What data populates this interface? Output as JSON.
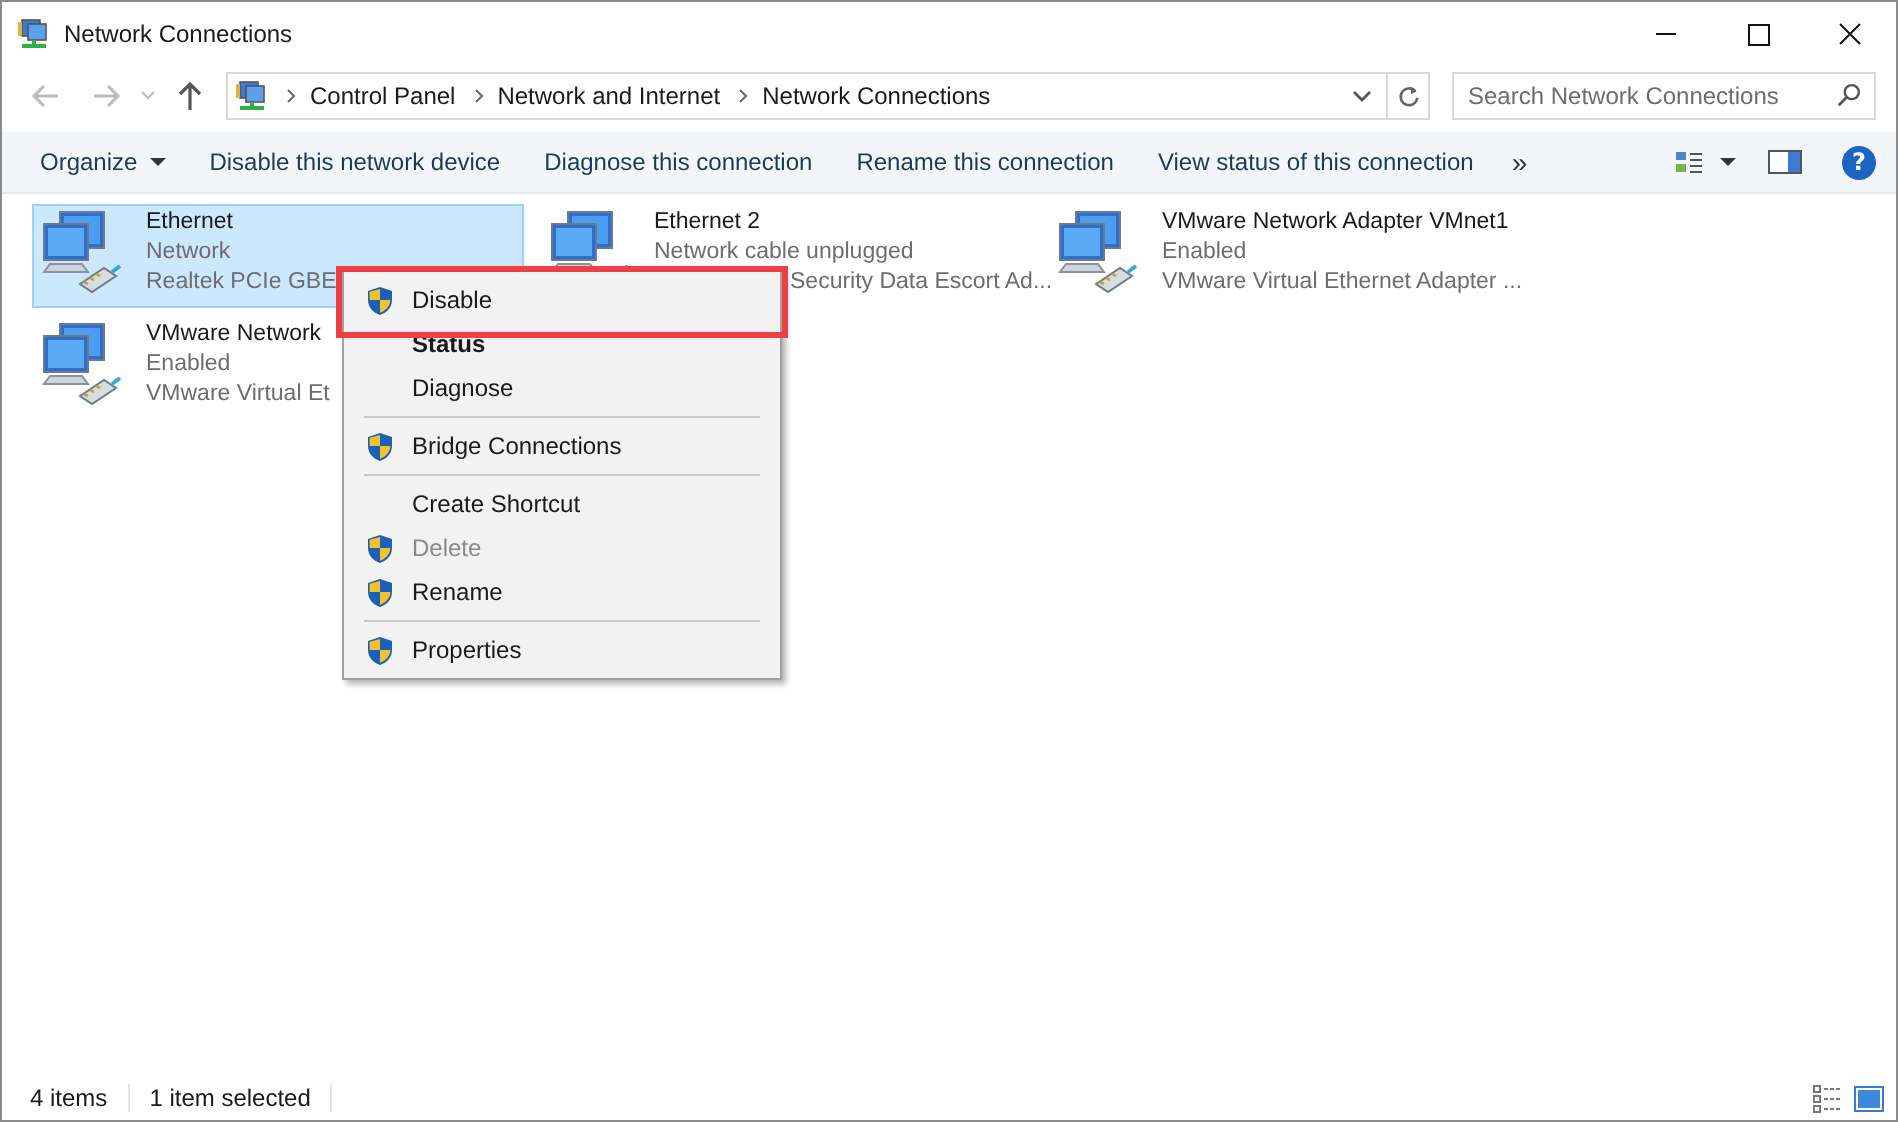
{
  "window": {
    "title": "Network Connections"
  },
  "address_bar": {
    "path": [
      "Control Panel",
      "Network and Internet",
      "Network Connections"
    ]
  },
  "search": {
    "placeholder": "Search Network Connections"
  },
  "toolbar": {
    "items": [
      {
        "label": "Organize",
        "dropdown": true
      },
      {
        "label": "Disable this network device",
        "dropdown": false
      },
      {
        "label": "Diagnose this connection",
        "dropdown": false
      },
      {
        "label": "Rename this connection",
        "dropdown": false
      },
      {
        "label": "View status of this connection",
        "dropdown": false
      }
    ],
    "overflow": "»",
    "help": "?"
  },
  "adapters": [
    {
      "name": "Ethernet",
      "lines": [
        "Network",
        "Realtek PCIe GBE"
      ],
      "selected": true
    },
    {
      "name": "Ethernet 2",
      "lines": [
        "Network cable unplugged",
        "Security Data Escort Ad..."
      ],
      "selected": false
    },
    {
      "name": "VMware Network Adapter VMnet1",
      "lines": [
        "Enabled",
        "VMware Virtual Ethernet Adapter ..."
      ],
      "selected": false
    },
    {
      "name": "VMware Network",
      "lines": [
        "Enabled",
        "VMware Virtual Et"
      ],
      "selected": false
    }
  ],
  "context_menu": {
    "items": [
      {
        "kind": "item",
        "label": "Disable",
        "shield": true,
        "bold": false,
        "disabled": false,
        "highlighted": true
      },
      {
        "kind": "item",
        "label": "Status",
        "shield": false,
        "bold": true,
        "disabled": false,
        "highlighted": false
      },
      {
        "kind": "item",
        "label": "Diagnose",
        "shield": false,
        "bold": false,
        "disabled": false,
        "highlighted": false
      },
      {
        "kind": "separator"
      },
      {
        "kind": "item",
        "label": "Bridge Connections",
        "shield": true,
        "bold": false,
        "disabled": false,
        "highlighted": false
      },
      {
        "kind": "separator"
      },
      {
        "kind": "item",
        "label": "Create Shortcut",
        "shield": false,
        "bold": false,
        "disabled": false,
        "highlighted": false
      },
      {
        "kind": "item",
        "label": "Delete",
        "shield": true,
        "bold": false,
        "disabled": true,
        "highlighted": false
      },
      {
        "kind": "item",
        "label": "Rename",
        "shield": true,
        "bold": false,
        "disabled": false,
        "highlighted": false
      },
      {
        "kind": "separator"
      },
      {
        "kind": "item",
        "label": "Properties",
        "shield": true,
        "bold": false,
        "disabled": false,
        "highlighted": false
      }
    ]
  },
  "status_bar": {
    "items": [
      "4 items",
      "1 item selected"
    ]
  }
}
